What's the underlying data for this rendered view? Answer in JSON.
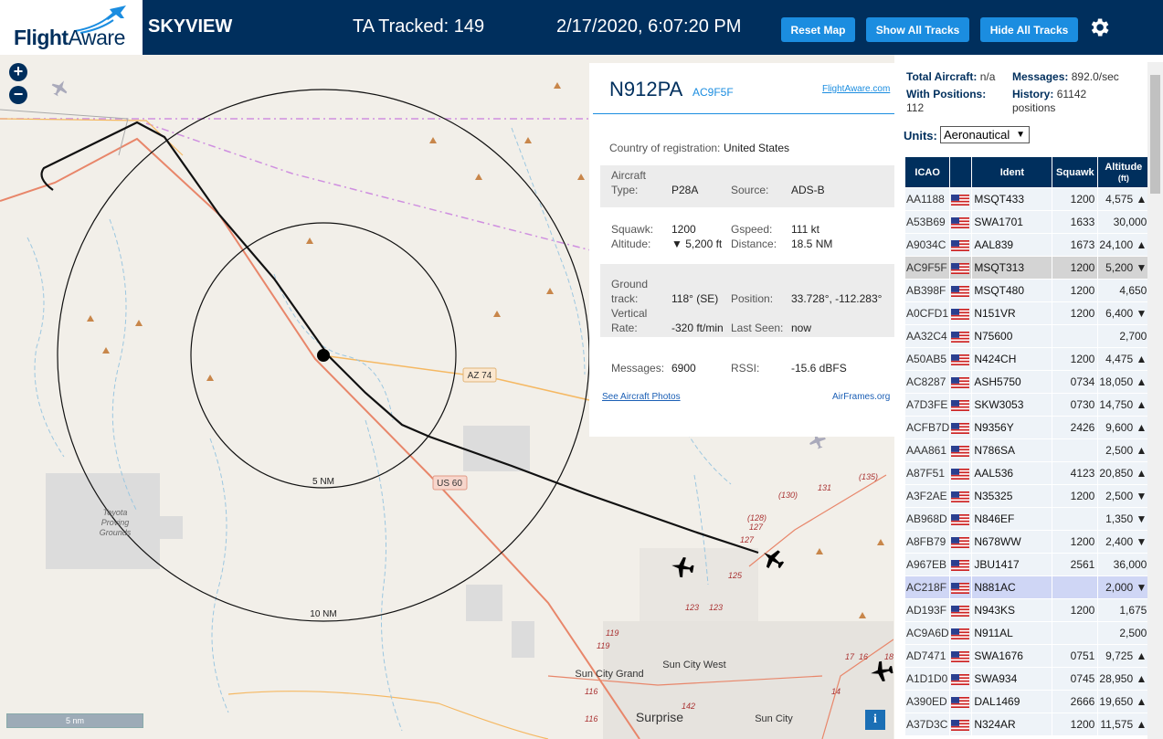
{
  "header": {
    "logo_flight": "Flight",
    "logo_aware": "Aware",
    "app_title": "SKYVIEW",
    "tracked_label": "TA Tracked: 149",
    "datetime": "2/17/2020, 6:07:20 PM",
    "reset_map": "Reset Map",
    "show_all_tracks": "Show All Tracks",
    "hide_all_tracks": "Hide All Tracks"
  },
  "map": {
    "zoom_in": "+",
    "zoom_out": "−",
    "ring_5": "5 NM",
    "ring_10": "10 NM",
    "road_az74": "AZ 74",
    "road_us60": "US 60",
    "proving_grounds_1": "Toyota",
    "proving_grounds_2": "Proving",
    "proving_grounds_3": "Grounds",
    "town_sun_city_grand": "Sun City Grand",
    "town_sun_city_west": "Sun City West",
    "town_surprise": "Surprise",
    "town_sun_city": "Sun City",
    "scale": "5 nm",
    "info": "i",
    "route_labels": [
      "(130)",
      "131",
      "(135)",
      "(128)",
      "127",
      "127",
      "125",
      "123",
      "123",
      "119",
      "119",
      "116",
      "116",
      "142",
      "14",
      "17",
      "16",
      "18"
    ]
  },
  "detail": {
    "registration": "N912PA",
    "hex": "AC9F5F",
    "fa_link": "FlightAware.com",
    "country_label": "Country of registration:",
    "country": "United States",
    "aircraft_type_label_1": "Aircraft",
    "aircraft_type_label_2": "Type:",
    "aircraft_type": "P28A",
    "source_label": "Source:",
    "source": "ADS-B",
    "squawk_label": "Squawk:",
    "squawk": "1200",
    "gspeed_label": "Gspeed:",
    "gspeed": "111 kt",
    "altitude_label": "Altitude:",
    "altitude": "▼ 5,200 ft",
    "distance_label": "Distance:",
    "distance": "18.5 NM",
    "ground_label_1": "Ground",
    "ground_label_2": "track:",
    "ground_track": "118° (SE)",
    "position_label": "Position:",
    "position": "33.728°, -112.283°",
    "vrate_label_1": "Vertical",
    "vrate_label_2": "Rate:",
    "vrate": "-320 ft/min",
    "last_seen_label": "Last Seen:",
    "last_seen": "now",
    "messages_label": "Messages:",
    "messages": "6900",
    "rssi_label": "RSSI:",
    "rssi": "-15.6 dBFS",
    "photos_link": "See Aircraft Photos",
    "airframes_link": "AirFrames.org"
  },
  "sidebar": {
    "total_label": "Total Aircraft:",
    "total_value": "n/a",
    "messages_label": "Messages:",
    "messages_value": "892.0/sec",
    "positions_label": "With Positions:",
    "positions_value": "112",
    "history_label": "History:",
    "history_value": "61142",
    "history_unit": "positions",
    "units_label": "Units:",
    "units_value": "Aeronautical",
    "columns": {
      "icao": "ICAO",
      "ident": "Ident",
      "squawk": "Squawk",
      "alt_1": "Altitude",
      "alt_2": "(ft)"
    },
    "rows": [
      {
        "icao": "AA1188",
        "ident": "MSQT433",
        "squawk": "1200",
        "alt": "4,575 ▲"
      },
      {
        "icao": "A53B69",
        "ident": "SWA1701",
        "squawk": "1633",
        "alt": "30,000"
      },
      {
        "icao": "A9034C",
        "ident": "AAL839",
        "squawk": "1673",
        "alt": "24,100 ▲"
      },
      {
        "icao": "AC9F5F",
        "ident": "MSQT313",
        "squawk": "1200",
        "alt": "5,200 ▼"
      },
      {
        "icao": "AB398F",
        "ident": "MSQT480",
        "squawk": "1200",
        "alt": "4,650"
      },
      {
        "icao": "A0CFD1",
        "ident": "N151VR",
        "squawk": "1200",
        "alt": "6,400 ▼"
      },
      {
        "icao": "AA32C4",
        "ident": "N75600",
        "squawk": "",
        "alt": "2,700"
      },
      {
        "icao": "A50AB5",
        "ident": "N424CH",
        "squawk": "1200",
        "alt": "4,475 ▲"
      },
      {
        "icao": "AC8287",
        "ident": "ASH5750",
        "squawk": "0734",
        "alt": "18,050 ▲"
      },
      {
        "icao": "A7D3FE",
        "ident": "SKW3053",
        "squawk": "0730",
        "alt": "14,750 ▲"
      },
      {
        "icao": "ACFB7D",
        "ident": "N9356Y",
        "squawk": "2426",
        "alt": "9,600 ▲"
      },
      {
        "icao": "AAA861",
        "ident": "N786SA",
        "squawk": "",
        "alt": "2,500 ▲"
      },
      {
        "icao": "A87F51",
        "ident": "AAL536",
        "squawk": "4123",
        "alt": "20,850 ▲"
      },
      {
        "icao": "A3F2AE",
        "ident": "N35325",
        "squawk": "1200",
        "alt": "2,500 ▼"
      },
      {
        "icao": "AB968D",
        "ident": "N846EF",
        "squawk": "",
        "alt": "1,350 ▼"
      },
      {
        "icao": "A8FB79",
        "ident": "N678WW",
        "squawk": "1200",
        "alt": "2,400 ▼"
      },
      {
        "icao": "A967EB",
        "ident": "JBU1417",
        "squawk": "2561",
        "alt": "36,000"
      },
      {
        "icao": "AC218F",
        "ident": "N881AC",
        "squawk": "",
        "alt": "2,000 ▼"
      },
      {
        "icao": "AD193F",
        "ident": "N943KS",
        "squawk": "1200",
        "alt": "1,675"
      },
      {
        "icao": "AC9A6D",
        "ident": "N911AL",
        "squawk": "",
        "alt": "2,500"
      },
      {
        "icao": "AD7471",
        "ident": "SWA1676",
        "squawk": "0751",
        "alt": "9,725 ▲"
      },
      {
        "icao": "A1D1D0",
        "ident": "SWA934",
        "squawk": "0745",
        "alt": "28,950 ▲"
      },
      {
        "icao": "A390ED",
        "ident": "DAL1469",
        "squawk": "2666",
        "alt": "19,650 ▲"
      },
      {
        "icao": "A37D3C",
        "ident": "N324AR",
        "squawk": "1200",
        "alt": "11,575 ▲"
      }
    ],
    "selected_row": 3,
    "highlight_row": 17
  },
  "colors": {
    "brand_navy": "#002f5d",
    "button_blue": "#1b8de0",
    "highway": "#e8866a",
    "road_orange": "#f5b862",
    "county_line": "#cf8fe0"
  }
}
